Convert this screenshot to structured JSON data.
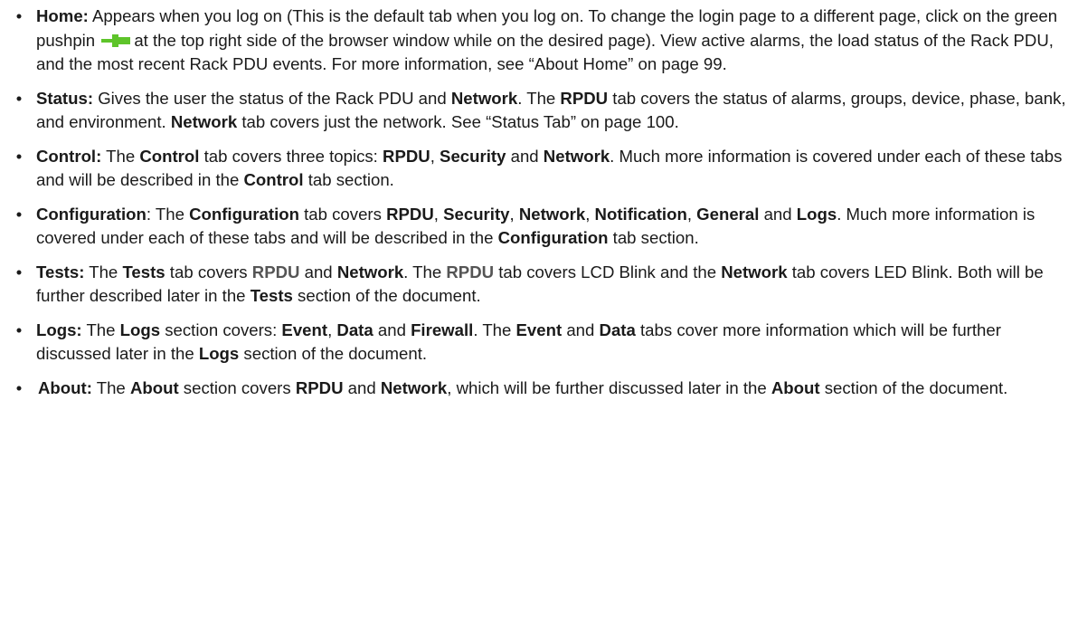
{
  "bullet": "•",
  "colors": {
    "text": "#1a1a1a",
    "pushpin": "#5ec42a",
    "gray_bold": "#555555"
  },
  "icons": {
    "pushpin": "green-pushpin-icon"
  },
  "items": [
    {
      "id": "home",
      "t0": "Home:",
      "t1": " Appears when you log on (This is the default tab when you log on. To change the login page to a different page, click on the green pushpin",
      "t2": "at the top right side of the browser window while on the desired page). View active alarms, the load status of the Rack PDU, and the most recent Rack PDU events. For more information, see “About Home” on page 99."
    },
    {
      "id": "status",
      "t0": "Status:",
      "t1": " Gives the user the status of the Rack PDU and ",
      "t2": "Network",
      "t3": ". The ",
      "t4": "RPDU",
      "t5": " tab covers the status of alarms, groups, device, phase, bank, and environment. ",
      "t6": "Network",
      "t7": " tab covers just the network. See “Status Tab” on page 100."
    },
    {
      "id": "control",
      "t0": "Control:",
      "t1": " The ",
      "t2": "Control",
      "t3": " tab covers three topics: ",
      "t4": "RPDU",
      "t5": ", ",
      "t6": "Security",
      "t7": " and ",
      "t8": "Network",
      "t9": ". Much more information is covered under each of these tabs and will be described in the ",
      "t10": "Control",
      "t11": " tab section."
    },
    {
      "id": "configuration",
      "t0": "Configuration",
      "t1": ": The ",
      "t2": "Configuration",
      "t3": " tab covers ",
      "t4": "RPDU",
      "t5": ", ",
      "t6": "Security",
      "t7": ", ",
      "t8": "Network",
      "t9": ", ",
      "t10": "Notification",
      "t11": ", ",
      "t12": "General",
      "t13": " and ",
      "t14": "Logs",
      "t15": ". Much more information is covered under each of these tabs and will be described in the ",
      "t16": "Configuration",
      "t17": " tab section."
    },
    {
      "id": "tests",
      "t0": "Tests:",
      "t1": " The ",
      "t2": "Tests",
      "t3": " tab covers ",
      "t4": "RPDU",
      "t5": " and ",
      "t6": "Network",
      "t7": ". The ",
      "t8": "RPDU",
      "t9": " tab covers LCD Blink and the ",
      "t10": "Network",
      "t11": " tab covers LED Blink. Both will be further described later in the ",
      "t12": "Tests",
      "t13": " section of the document."
    },
    {
      "id": "logs",
      "t0": "Logs:",
      "t1": " The ",
      "t2": "Logs",
      "t3": " section covers: ",
      "t4": "Event",
      "t5": ", ",
      "t6": "Data",
      "t7": " and ",
      "t8": "Firewall",
      "t9": ". The ",
      "t10": "Event",
      "t11": " and ",
      "t12": "Data",
      "t13": " tabs cover more information which will be further discussed later in the ",
      "t14": "Logs",
      "t15": " section of the document."
    },
    {
      "id": "about",
      "t0": "About:",
      "t1": " The ",
      "t2": "About",
      "t3": " section covers ",
      "t4": "RPDU",
      "t5": " and ",
      "t6": "Network",
      "t7": ", which will be further discussed later in the ",
      "t8": "About",
      "t9": " section of the document."
    }
  ]
}
